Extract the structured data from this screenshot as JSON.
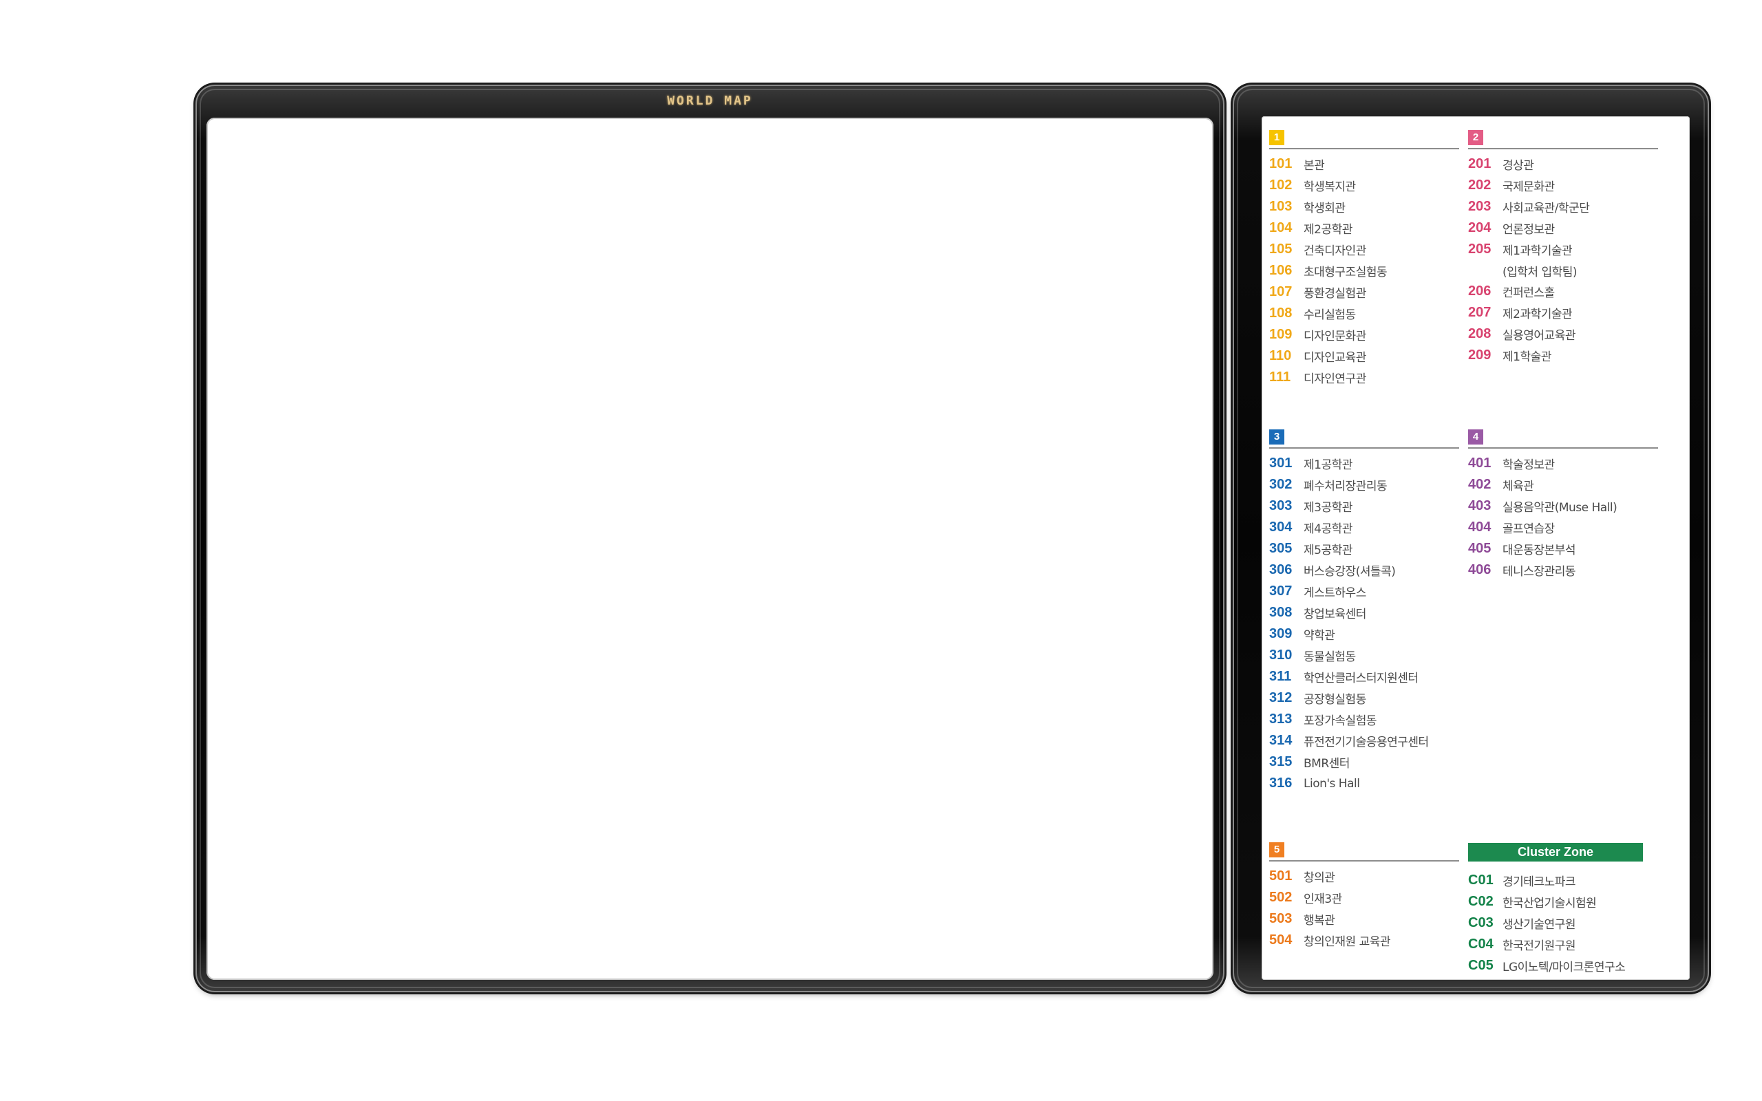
{
  "window": {
    "title": "WORLD MAP"
  },
  "legend": {
    "sections": [
      {
        "badge": "1",
        "items": [
          {
            "code": "101",
            "name": "본관"
          },
          {
            "code": "102",
            "name": "학생복지관"
          },
          {
            "code": "103",
            "name": "학생회관"
          },
          {
            "code": "104",
            "name": "제2공학관"
          },
          {
            "code": "105",
            "name": "건축디자인관"
          },
          {
            "code": "106",
            "name": "초대형구조실험동"
          },
          {
            "code": "107",
            "name": "풍환경실험관"
          },
          {
            "code": "108",
            "name": "수리실험동"
          },
          {
            "code": "109",
            "name": "디자인문화관"
          },
          {
            "code": "110",
            "name": "디자인교육관"
          },
          {
            "code": "111",
            "name": "디자인연구관"
          }
        ]
      },
      {
        "badge": "2",
        "items": [
          {
            "code": "201",
            "name": "경상관"
          },
          {
            "code": "202",
            "name": "국제문화관"
          },
          {
            "code": "203",
            "name": "사회교육관/학군단"
          },
          {
            "code": "204",
            "name": "언론정보관"
          },
          {
            "code": "205",
            "name": "제1과학기술관"
          },
          {
            "code": "",
            "name": "(입학처 입학팀)"
          },
          {
            "code": "206",
            "name": "컨퍼런스홀"
          },
          {
            "code": "207",
            "name": "제2과학기술관"
          },
          {
            "code": "208",
            "name": "실용영어교육관"
          },
          {
            "code": "209",
            "name": "제1학술관"
          }
        ]
      },
      {
        "badge": "3",
        "items": [
          {
            "code": "301",
            "name": "제1공학관"
          },
          {
            "code": "302",
            "name": "폐수처리장관리동"
          },
          {
            "code": "303",
            "name": "제3공학관"
          },
          {
            "code": "304",
            "name": "제4공학관"
          },
          {
            "code": "305",
            "name": "제5공학관"
          },
          {
            "code": "306",
            "name": "버스승강장(셔틀콕)"
          },
          {
            "code": "307",
            "name": "게스트하우스"
          },
          {
            "code": "308",
            "name": "창업보육센터"
          },
          {
            "code": "309",
            "name": "약학관"
          },
          {
            "code": "310",
            "name": "동물실험동"
          },
          {
            "code": "311",
            "name": "학연산클러스터지원센터"
          },
          {
            "code": "312",
            "name": "공장형실험동"
          },
          {
            "code": "313",
            "name": "포장가속실험동"
          },
          {
            "code": "314",
            "name": "퓨전전기기술응용연구센터"
          },
          {
            "code": "315",
            "name": "BMR센터"
          },
          {
            "code": "316",
            "name": "Lion's Hall"
          }
        ]
      },
      {
        "badge": "4",
        "items": [
          {
            "code": "401",
            "name": "학술정보관"
          },
          {
            "code": "402",
            "name": "체육관"
          },
          {
            "code": "403",
            "name": "실용음악관(Muse Hall)"
          },
          {
            "code": "404",
            "name": "골프연습장"
          },
          {
            "code": "405",
            "name": "대운동장본부석"
          },
          {
            "code": "406",
            "name": "테니스장관리동"
          }
        ]
      },
      {
        "badge": "5",
        "items": [
          {
            "code": "501",
            "name": "창의관"
          },
          {
            "code": "502",
            "name": "인재3관"
          },
          {
            "code": "503",
            "name": "행복관"
          },
          {
            "code": "504",
            "name": "창의인재원 교육관"
          }
        ]
      }
    ],
    "cluster": {
      "title": "Cluster Zone",
      "items": [
        {
          "code": "C01",
          "name": "경기테크노파크"
        },
        {
          "code": "C02",
          "name": "한국산업기술시험원"
        },
        {
          "code": "C03",
          "name": "생산기술연구원"
        },
        {
          "code": "C04",
          "name": "한국전기원구원"
        },
        {
          "code": "C05",
          "name": "LG이노텍/마이크론연구소"
        }
      ]
    }
  }
}
